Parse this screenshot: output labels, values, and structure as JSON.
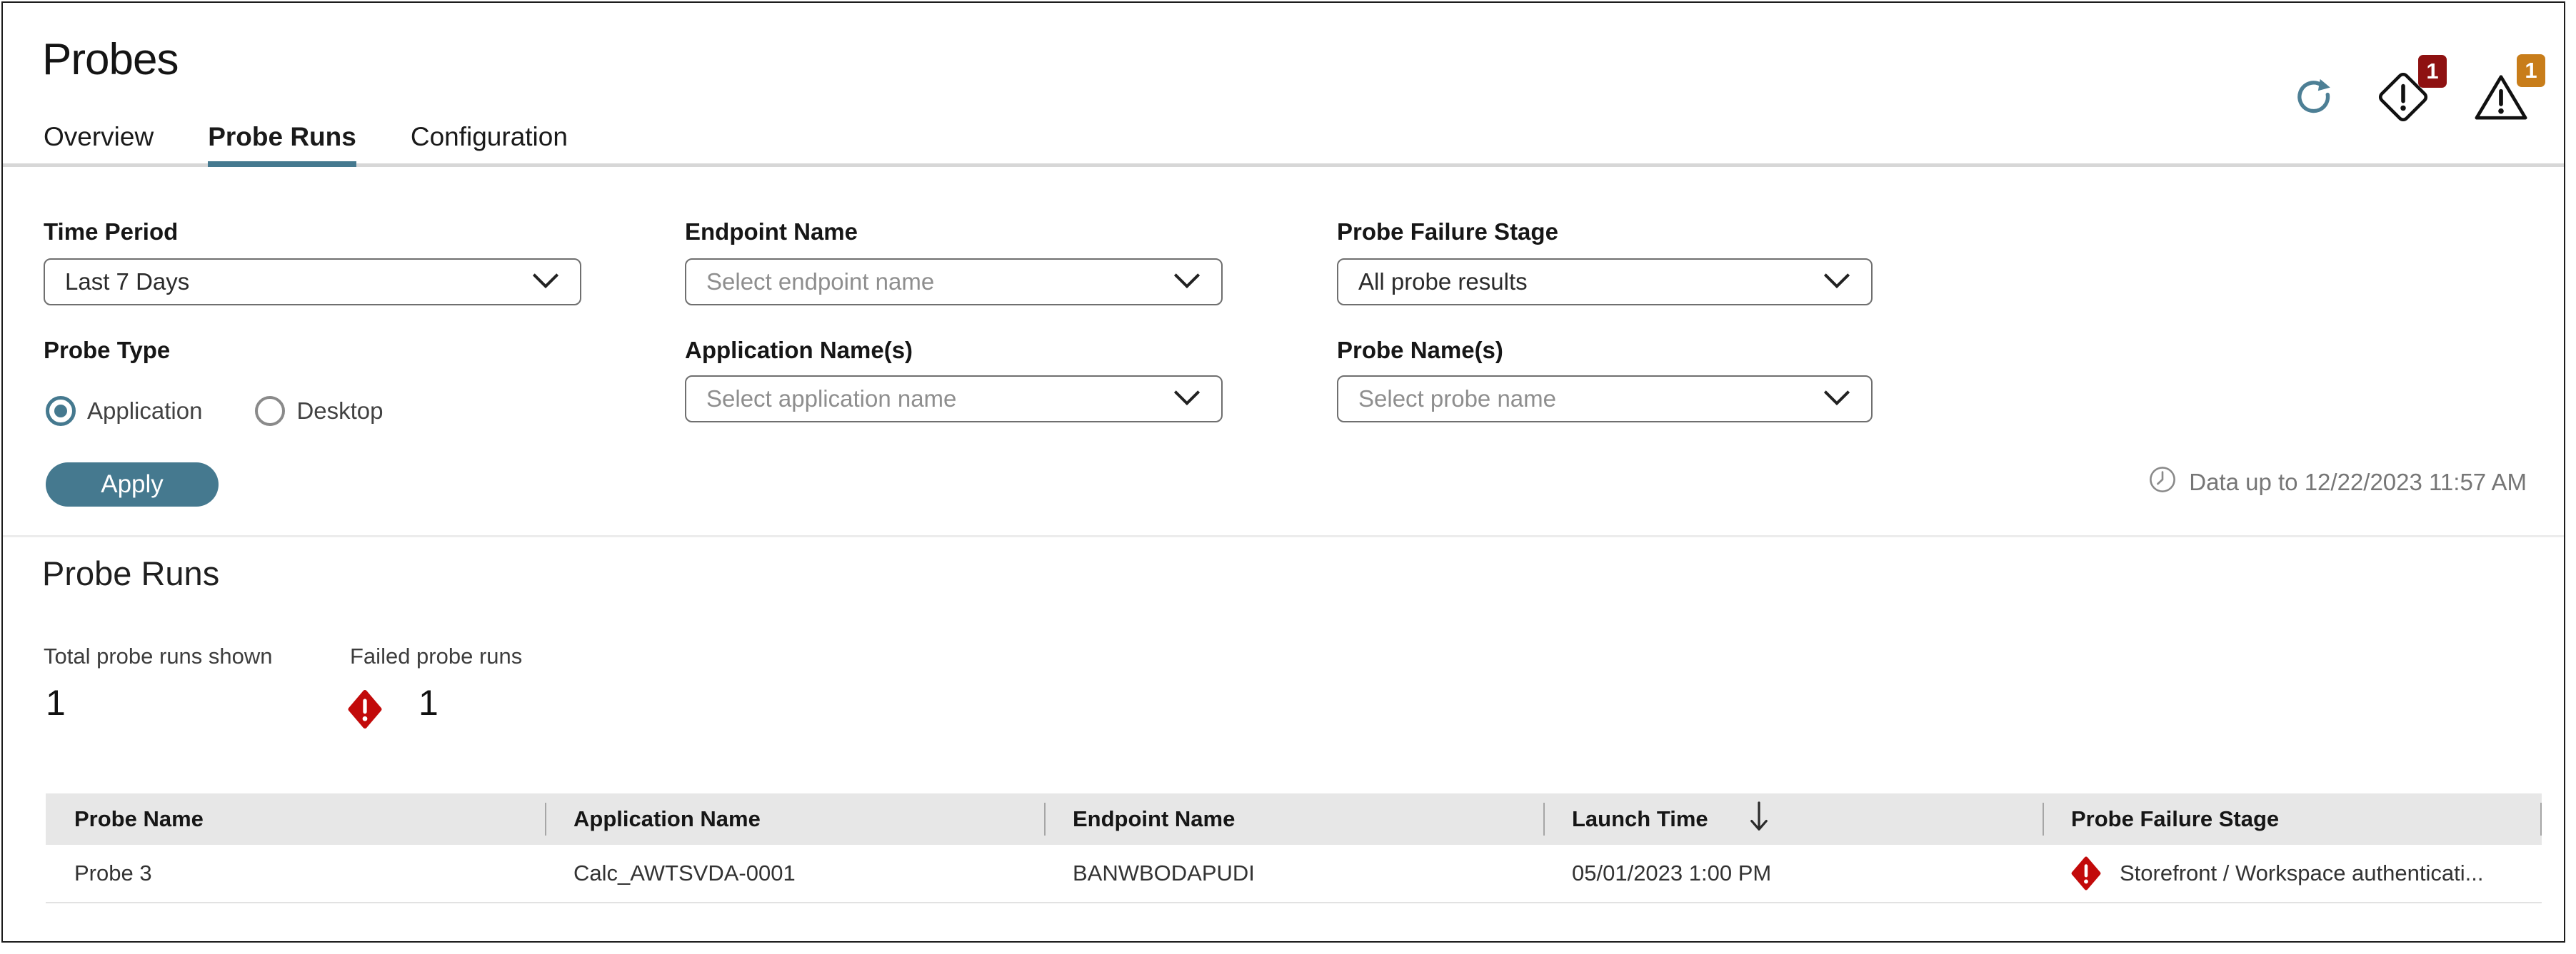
{
  "page": {
    "title": "Probes"
  },
  "header_icons": {
    "refresh": "refresh",
    "error_count": "1",
    "warning_count": "1"
  },
  "tabs": [
    {
      "label": "Overview",
      "active": false
    },
    {
      "label": "Probe Runs",
      "active": true
    },
    {
      "label": "Configuration",
      "active": false
    }
  ],
  "filters": {
    "time_period": {
      "label": "Time Period",
      "value": "Last 7 Days"
    },
    "endpoint_name": {
      "label": "Endpoint Name",
      "placeholder": "Select endpoint name"
    },
    "probe_failure_stage": {
      "label": "Probe Failure Stage",
      "value": "All probe results"
    },
    "probe_type": {
      "label": "Probe Type",
      "options": [
        {
          "label": "Application",
          "selected": true
        },
        {
          "label": "Desktop",
          "selected": false
        }
      ]
    },
    "application_names": {
      "label": "Application Name(s)",
      "placeholder": "Select application name"
    },
    "probe_names": {
      "label": "Probe Name(s)",
      "placeholder": "Select probe name"
    },
    "apply_label": "Apply",
    "data_freshness": "Data up to 12/22/2023 11:57 AM"
  },
  "section": {
    "title": "Probe Runs",
    "stats": [
      {
        "label": "Total probe runs shown",
        "value": "1"
      },
      {
        "label": "Failed probe runs",
        "value": "1",
        "icon": "error-diamond"
      }
    ]
  },
  "table": {
    "columns": [
      "Probe Name",
      "Application Name",
      "Endpoint Name",
      "Launch Time",
      "Probe Failure Stage"
    ],
    "sort_column": "Launch Time",
    "sort_direction": "descending",
    "rows": [
      {
        "probe_name": "Probe 3",
        "application_name": "Calc_AWTSVDA-0001",
        "endpoint_name": "BANWBODAPUDI",
        "launch_time": "05/01/2023 1:00 PM",
        "probe_failure_stage": "Storefront / Workspace authenticati...",
        "failed": true
      }
    ]
  },
  "colors": {
    "accent": "#45798f",
    "error-red": "#c20a0a",
    "error-badge": "#8e1111",
    "warn-badge": "#c87d1a",
    "header-gray": "#e7e7e7",
    "muted": "#767676"
  }
}
